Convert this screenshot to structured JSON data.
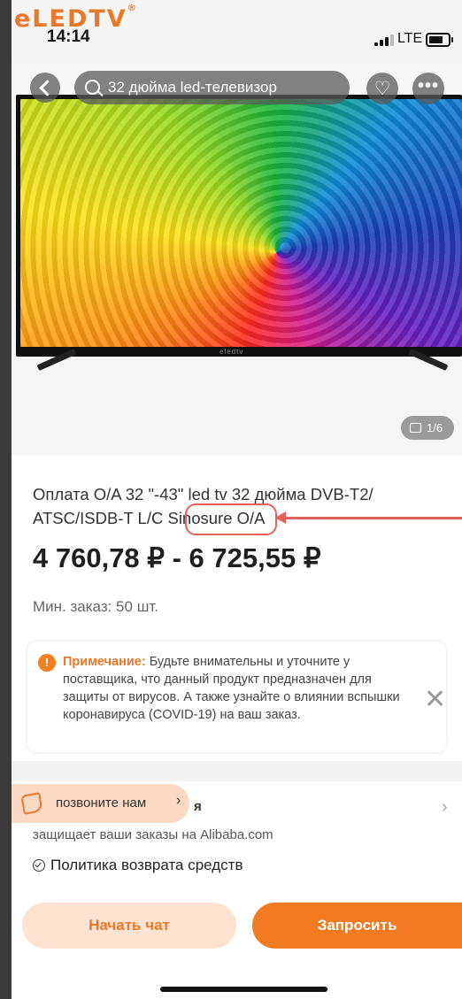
{
  "brand": {
    "logo_text": "eLEDTV",
    "logo_mark": "®",
    "accent_color": "#e8792c"
  },
  "status_bar": {
    "time": "14:14",
    "network": "LTE"
  },
  "header": {
    "search_query": "32 дюйма led-телевизор",
    "back_icon": "back-arrow-icon",
    "favorite_icon": "heart-icon",
    "more_icon": "more-dots-icon",
    "more_glyph": "•••"
  },
  "gallery": {
    "image_counter": "1/6",
    "tv_brand": "eledtv"
  },
  "product": {
    "title": "Оплата O/A 32 \"-43\" led tv 32 дюйма DVB-T2/ ATSC/ISDB-T L/C Sinosure O/A",
    "price": "4 760,78 ₽ - 6 725,55 ₽",
    "min_order": "Мин. заказ: 50 шт.",
    "highlighted_word": "Sinosure",
    "highlight_color": "#e8605a"
  },
  "note": {
    "icon": "!",
    "label": "Примечание:",
    "text": "Будьте внимательны и уточните у поставщика, что данный продукт предназначен для защиты от вирусов. А также узнайте о влиянии вспышки коронавируса (COVID-19) на ваш заказ.",
    "close_glyph": "✕"
  },
  "protection": {
    "call_label": "позвоните нам",
    "call_chevron": "›",
    "trade_peek": "я",
    "chevron": "›",
    "description": "защищает ваши заказы на Alibaba.com",
    "refund_policy": "Политика возврата средств"
  },
  "footer": {
    "chat_button": "Начать чат",
    "request_button": "Запросить",
    "primary_color": "#f27a20"
  }
}
